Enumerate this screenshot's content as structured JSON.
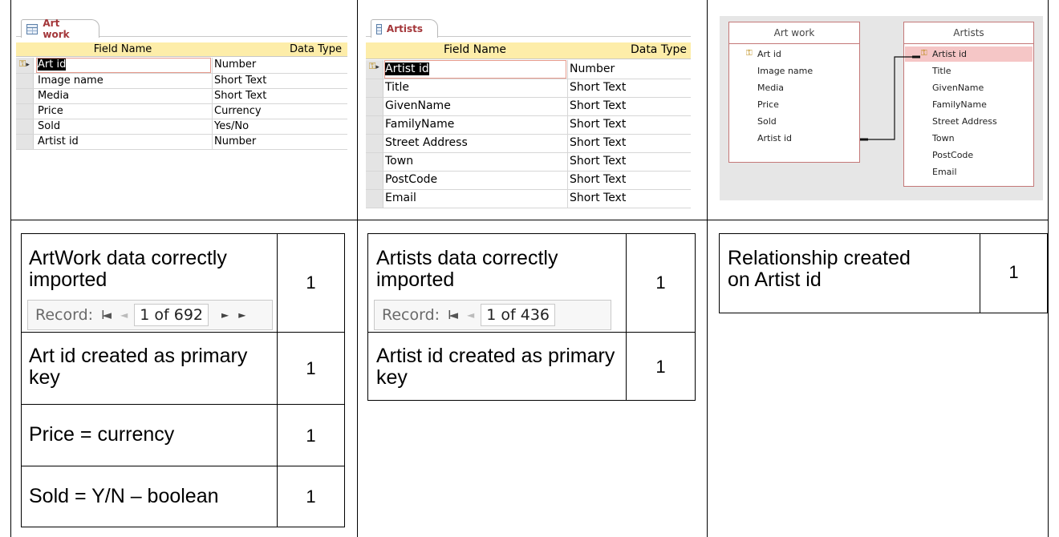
{
  "artwork_design": {
    "tab_label": "Art work",
    "col_field": "Field Name",
    "col_type": "Data Type",
    "rows": [
      {
        "name": "Art id",
        "type": "Number"
      },
      {
        "name": "Image name",
        "type": "Short Text"
      },
      {
        "name": "Media",
        "type": "Short Text"
      },
      {
        "name": "Price",
        "type": "Currency"
      },
      {
        "name": "Sold",
        "type": "Yes/No"
      },
      {
        "name": "Artist id",
        "type": "Number"
      }
    ]
  },
  "artists_design": {
    "tab_label": "Artists",
    "col_field": "Field Name",
    "col_type": "Data Type",
    "rows": [
      {
        "name": "Artist id",
        "type": "Number"
      },
      {
        "name": "Title",
        "type": "Short Text"
      },
      {
        "name": "GivenName",
        "type": "Short Text"
      },
      {
        "name": "FamilyName",
        "type": "Short Text"
      },
      {
        "name": "Street Address",
        "type": "Short Text"
      },
      {
        "name": "Town",
        "type": "Short Text"
      },
      {
        "name": "PostCode",
        "type": "Short Text"
      },
      {
        "name": "Email",
        "type": "Short Text"
      }
    ]
  },
  "relationships": {
    "left_table": {
      "title": "Art work",
      "fields": [
        "Art id",
        "Image name",
        "Media",
        "Price",
        "Sold",
        "Artist id"
      ]
    },
    "right_table": {
      "title": "Artists",
      "fields": [
        "Artist id",
        "Title",
        "GivenName",
        "FamilyName",
        "Street Address",
        "Town",
        "PostCode",
        "Email"
      ]
    }
  },
  "marks": {
    "col1": [
      {
        "text": "ArtWork data correctly imported",
        "score": "1",
        "record_nav": {
          "label": "Record:",
          "first": "I◄",
          "prev": "◄",
          "value": "1 of 692",
          "next": "►",
          "last": "►"
        }
      },
      {
        "text": "Art id created as primary key",
        "score": "1"
      },
      {
        "text": "Price = currency",
        "score": "1"
      },
      {
        "text": "Sold = Y/N – boolean",
        "score": "1"
      }
    ],
    "col2": [
      {
        "text": "Artists data correctly imported",
        "score": "1",
        "record_nav": {
          "label": "Record:",
          "first": "I◄",
          "prev": "◄",
          "value": "1 of 436"
        }
      },
      {
        "text": "Artist id created as primary key",
        "score": "1"
      }
    ],
    "col3": [
      {
        "text": "Relationship created on Artist id",
        "score": "1"
      }
    ]
  },
  "colors": {
    "header_bg": "#fdeda9",
    "tab_text": "#a4373a",
    "relation_border": "#c47878",
    "relation_highlight": "#f5c6c6"
  }
}
